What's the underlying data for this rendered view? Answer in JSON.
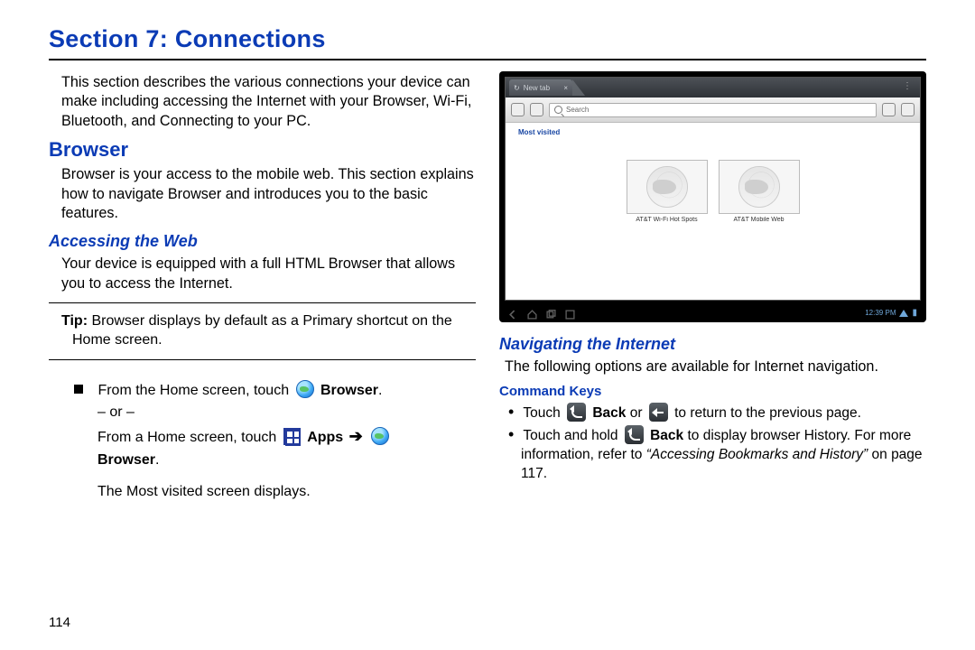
{
  "section_title": "Section 7: Connections",
  "intro": "This section describes the various connections your device can make including accessing the Internet with your Browser, Wi-Fi, Bluetooth, and Connecting to your PC.",
  "h_browser": "Browser",
  "browser_intro": "Browser is your access to the mobile web. This section explains how to navigate Browser and introduces you to the basic features.",
  "h_accessing": "Accessing the Web",
  "accessing_body": "Your device is equipped with a full HTML Browser that allows you to access the Internet.",
  "tip_label": "Tip:",
  "tip_body": " Browser displays by default as a Primary shortcut on the Home screen.",
  "step_from_home_pre": "From the Home screen, touch ",
  "browser_word": "Browser",
  "or_sep": "– or –",
  "step_from_home2_pre": "From a Home screen, touch ",
  "apps_word": "Apps",
  "arrow": "➔",
  "most_visited_line": "The Most visited screen displays.",
  "h_navigating": "Navigating the Internet",
  "nav_body": "The following options are available for Internet navigation.",
  "h_command_keys": "Command Keys",
  "ck1_pre": "Touch ",
  "back_word": "Back",
  "ck1_mid": " or ",
  "ck1_post": " to return to the previous page.",
  "ck2_pre": "Touch and hold ",
  "ck2_mid": " to display browser History. For more information, refer to ",
  "ck2_ref": "“Accessing Bookmarks and History”",
  "ck2_post": " on page 117.",
  "page_number": "114",
  "tablet": {
    "tab_label": "New tab",
    "search_placeholder": "Search",
    "most_visited": "Most visited",
    "tile1": "AT&T Wi-Fi Hot Spots",
    "tile2": "AT&T Mobile Web",
    "clock": "12:39 PM",
    "menu_dots": "⋮",
    "tab_close": "×"
  }
}
